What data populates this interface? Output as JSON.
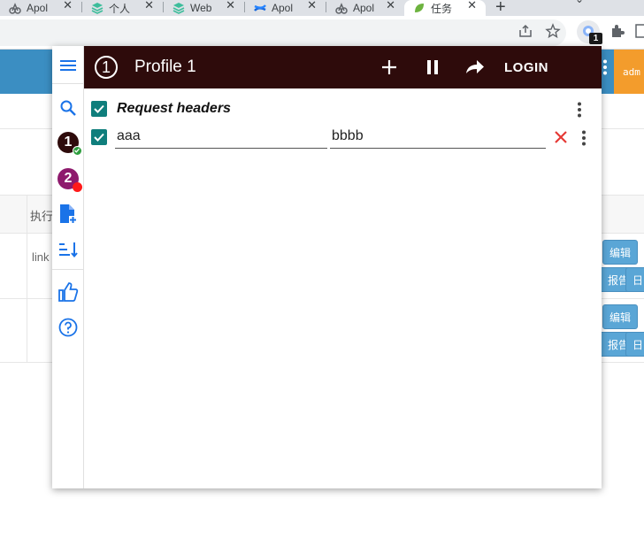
{
  "browser": {
    "tabs": [
      {
        "title": "Apol",
        "icon": "apollo-icon",
        "active": false
      },
      {
        "title": "个人",
        "icon": "stack-icon",
        "active": false
      },
      {
        "title": "Web",
        "icon": "stack-icon",
        "active": false
      },
      {
        "title": "Apol",
        "icon": "confluence-icon",
        "active": false
      },
      {
        "title": "Apol",
        "icon": "apollo-icon",
        "active": false
      },
      {
        "title": "任务",
        "icon": "leaf-icon",
        "active": true
      }
    ],
    "new_tab": "+",
    "extension_badge": "1"
  },
  "background": {
    "admin_label": "adm",
    "table_header_cell": "执行",
    "row_link_text": "link",
    "buttons": {
      "edit": "编辑",
      "report": "报告",
      "log": "日"
    }
  },
  "popup": {
    "profile_number": "1",
    "profile_title": "Profile 1",
    "login_label": "LOGIN",
    "sidebar": {
      "profiles": [
        {
          "number": "1",
          "color": "#2e0b0b",
          "status_color": "#2e9e3e"
        },
        {
          "number": "2",
          "color": "#8e1a6d",
          "status_color": "#ff1a1a"
        }
      ]
    },
    "section": {
      "title": "Request headers",
      "enabled": true
    },
    "headers": [
      {
        "enabled": true,
        "name": "aaa",
        "value": "bbbb"
      }
    ]
  },
  "colors": {
    "accent_blue": "#1a73e8",
    "topbar": "#2e0b0b",
    "checkbox": "#0f7e7c",
    "clear_red": "#e53935"
  }
}
